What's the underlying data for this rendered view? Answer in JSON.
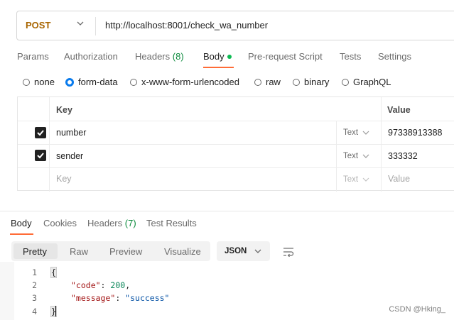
{
  "request": {
    "method": "POST",
    "url": "http://localhost:8001/check_wa_number"
  },
  "request_tabs": {
    "params": "Params",
    "authorization": "Authorization",
    "headers": "Headers",
    "headers_count": "(8)",
    "body": "Body",
    "prerequest": "Pre-request Script",
    "tests": "Tests",
    "settings": "Settings"
  },
  "body_types": {
    "none": "none",
    "form_data": "form-data",
    "urlencoded": "x-www-form-urlencoded",
    "raw": "raw",
    "binary": "binary",
    "graphql": "GraphQL",
    "selected": "form-data"
  },
  "form_table": {
    "headers": {
      "key": "Key",
      "value": "Value"
    },
    "rows": [
      {
        "checked": true,
        "key": "number",
        "type": "Text",
        "value": "97338913388"
      },
      {
        "checked": true,
        "key": "sender",
        "type": "Text",
        "value": "333332"
      }
    ],
    "placeholder": {
      "key": "Key",
      "type": "Text",
      "value": "Value"
    }
  },
  "response_tabs": {
    "body": "Body",
    "cookies": "Cookies",
    "headers": "Headers",
    "headers_count": "(7)",
    "test_results": "Test Results"
  },
  "view_modes": {
    "pretty": "Pretty",
    "raw": "Raw",
    "preview": "Preview",
    "visualize": "Visualize",
    "selected": "Pretty"
  },
  "format": "JSON",
  "response_code": {
    "line_numbers": [
      "1",
      "2",
      "3",
      "4"
    ],
    "open_brace": "{",
    "close_brace": "}",
    "line2_key": "\"code\"",
    "line2_sep": ": ",
    "line2_value": "200",
    "line2_end": ",",
    "line3_key": "\"message\"",
    "line3_sep": ": ",
    "line3_value": "\"success\""
  },
  "watermark": "CSDN @Hking_",
  "colors": {
    "method": "#a86500",
    "accent": "#ff6c37",
    "body_dot": "#0cbb52",
    "radio_selected": "#097bed",
    "count": "#0b8a3c"
  },
  "icons": {
    "method_dropdown": "chevron-down-icon",
    "type_dropdown": "chevron-down-icon",
    "format_dropdown": "chevron-down-icon",
    "wrap": "wrap-lines-icon",
    "checkbox": "checkmark-icon"
  }
}
